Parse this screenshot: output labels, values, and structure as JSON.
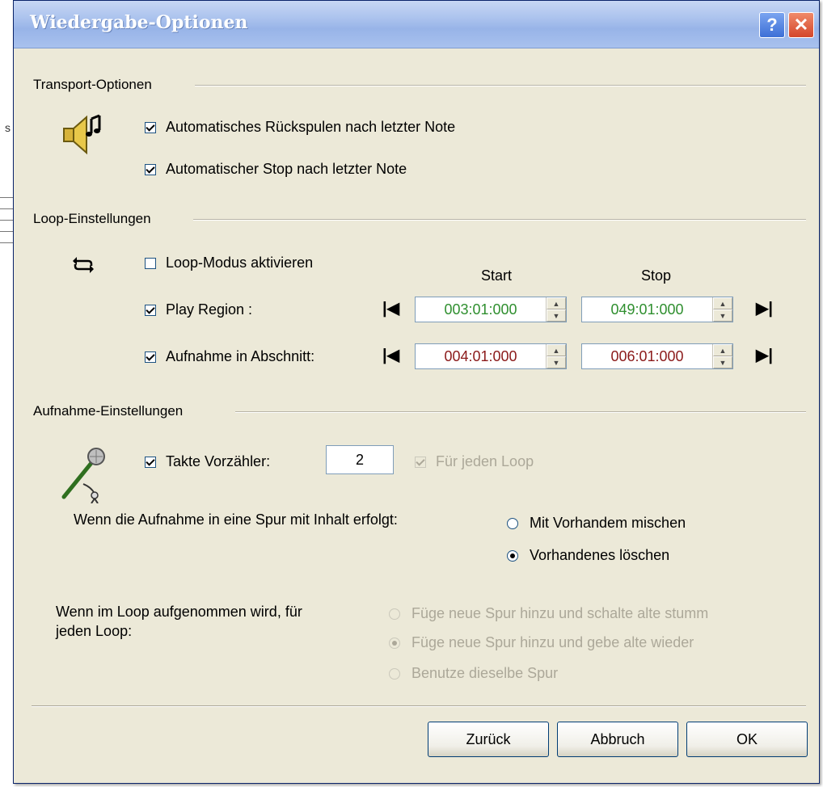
{
  "window": {
    "title": "Wiedergabe-Optionen",
    "help_label": "?",
    "close_label": "✕"
  },
  "background": {
    "mark": "s"
  },
  "transport": {
    "header": "Transport-Optionen",
    "icon": "speaker-music-icon",
    "auto_rewind": {
      "label": "Automatisches Rückspulen nach letzter Note",
      "checked": true
    },
    "auto_stop": {
      "label": "Automatischer Stop nach letzter Note",
      "checked": true
    }
  },
  "loop": {
    "header": "Loop-Einstellungen",
    "icon": "loop-arrows-icon",
    "loop_mode": {
      "label": "Loop-Modus aktivieren",
      "checked": false
    },
    "col_start": "Start",
    "col_stop": "Stop",
    "play_region": {
      "label": "Play Region :",
      "checked": true,
      "start": "003:01:000",
      "stop": "049:01:000",
      "color": "#2f8f2f"
    },
    "record_section": {
      "label": "Aufnahme in Abschnitt:",
      "checked": true,
      "start": "004:01:000",
      "stop": "006:01:000",
      "color": "#8b1a1a"
    }
  },
  "recording": {
    "header": "Aufnahme-Einstellungen",
    "icon": "microphone-icon",
    "count_in": {
      "label": "Takte Vorzähler:",
      "checked": true,
      "value": "2"
    },
    "each_loop": {
      "label": "Für jeden Loop",
      "checked": true,
      "disabled": true
    },
    "when_content_label": "Wenn die Aufnahme in eine Spur mit Inhalt erfolgt:",
    "content_options": [
      {
        "label": "Mit Vorhandem mischen",
        "checked": false
      },
      {
        "label": "Vorhandenes löschen",
        "checked": true
      }
    ],
    "when_loop_label_1": "Wenn im Loop aufgenommen wird, für",
    "when_loop_label_2": "jeden Loop:",
    "loop_options": [
      {
        "label": "Füge neue Spur hinzu und schalte alte stumm",
        "checked": false
      },
      {
        "label": "Füge neue Spur hinzu und gebe alte wieder",
        "checked": true
      },
      {
        "label": "Benutze dieselbe Spur",
        "checked": false
      }
    ]
  },
  "buttons": {
    "back": "Zurück",
    "cancel": "Abbruch",
    "ok": "OK"
  }
}
